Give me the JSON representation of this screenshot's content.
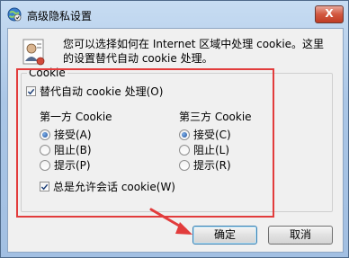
{
  "window": {
    "title": "高级隐私设置",
    "close_label": "X"
  },
  "info": {
    "text": "您可以选择如何在 Internet 区域中处理 cookie。这里的设置替代自动 cookie 处理。"
  },
  "group": {
    "title": "Cookie",
    "override_label": "替代自动 cookie 处理(O)",
    "override_checked": true,
    "first_party": {
      "title": "第一方 Cookie",
      "options": [
        "接受(A)",
        "阻止(B)",
        "提示(P)"
      ],
      "selected": 0
    },
    "third_party": {
      "title": "第三方 Cookie",
      "options": [
        "接受(C)",
        "阻止(L)",
        "提示(R)"
      ],
      "selected": 0
    },
    "session_label": "总是允许会话 cookie(W)",
    "session_checked": true
  },
  "buttons": {
    "ok": "确定",
    "cancel": "取消"
  },
  "colors": {
    "highlight": "#e23c3c"
  }
}
